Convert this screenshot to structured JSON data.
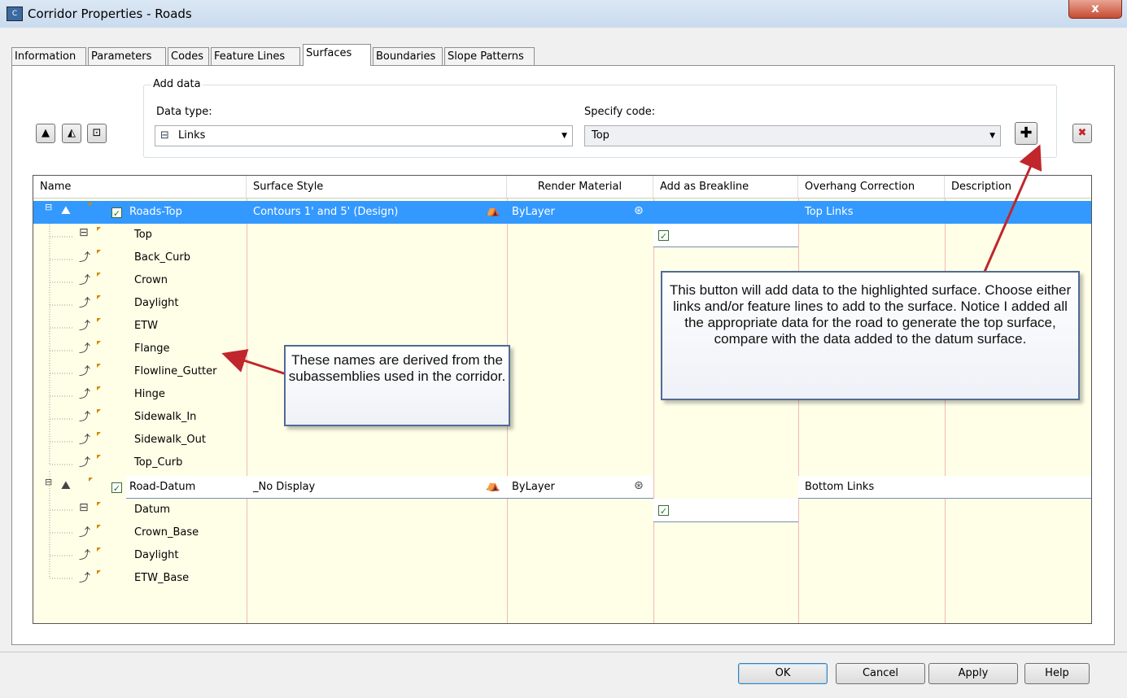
{
  "window": {
    "title": "Corridor Properties - Roads",
    "close_label": "x"
  },
  "tabs": [
    {
      "label": "Information"
    },
    {
      "label": "Parameters"
    },
    {
      "label": "Codes"
    },
    {
      "label": "Feature Lines"
    },
    {
      "label": "Surfaces",
      "active": true
    },
    {
      "label": "Boundaries"
    },
    {
      "label": "Slope Patterns"
    }
  ],
  "add_data": {
    "group_label": "Add data",
    "data_type_label": "Data type:",
    "data_type_value": "Links",
    "specify_code_label": "Specify code:",
    "specify_code_value": "Top"
  },
  "grid": {
    "columns": [
      "Name",
      "Surface Style",
      "Render Material",
      "Add as Breakline",
      "Overhang Correction",
      "Description"
    ],
    "surfaces": [
      {
        "name": "Roads-Top",
        "style": "Contours 1' and 5' (Design)",
        "material": "ByLayer",
        "overhang": "Top Links",
        "children": [
          {
            "name": "Top",
            "kind": "link"
          },
          {
            "name": "Back_Curb",
            "kind": "feature"
          },
          {
            "name": "Crown",
            "kind": "feature"
          },
          {
            "name": "Daylight",
            "kind": "feature"
          },
          {
            "name": "ETW",
            "kind": "feature"
          },
          {
            "name": "Flange",
            "kind": "feature"
          },
          {
            "name": "Flowline_Gutter",
            "kind": "feature"
          },
          {
            "name": "Hinge",
            "kind": "feature"
          },
          {
            "name": "Sidewalk_In",
            "kind": "feature"
          },
          {
            "name": "Sidewalk_Out",
            "kind": "feature"
          },
          {
            "name": "Top_Curb",
            "kind": "feature"
          }
        ]
      },
      {
        "name": "Road-Datum",
        "style": "_No Display",
        "material": "ByLayer",
        "overhang": "Bottom Links",
        "children": [
          {
            "name": "Datum",
            "kind": "link"
          },
          {
            "name": "Crown_Base",
            "kind": "feature"
          },
          {
            "name": "Daylight",
            "kind": "feature"
          },
          {
            "name": "ETW_Base",
            "kind": "feature"
          }
        ]
      }
    ]
  },
  "callouts": {
    "left": "These names are derived from the subassemblies used in the corridor.",
    "right": "This button will add data to the highlighted surface. Choose either links and/or feature lines to add to the surface. Notice I added all the appropriate data for the road to generate the top surface, compare with the data added to the datum surface."
  },
  "buttons": {
    "ok": "OK",
    "cancel": "Cancel",
    "apply": "Apply",
    "help": "Help"
  },
  "colors": {
    "selection": "#3399ff",
    "grid_bg": "#ffffe8",
    "callout_border": "#506a96",
    "arrow": "#c0262c"
  }
}
